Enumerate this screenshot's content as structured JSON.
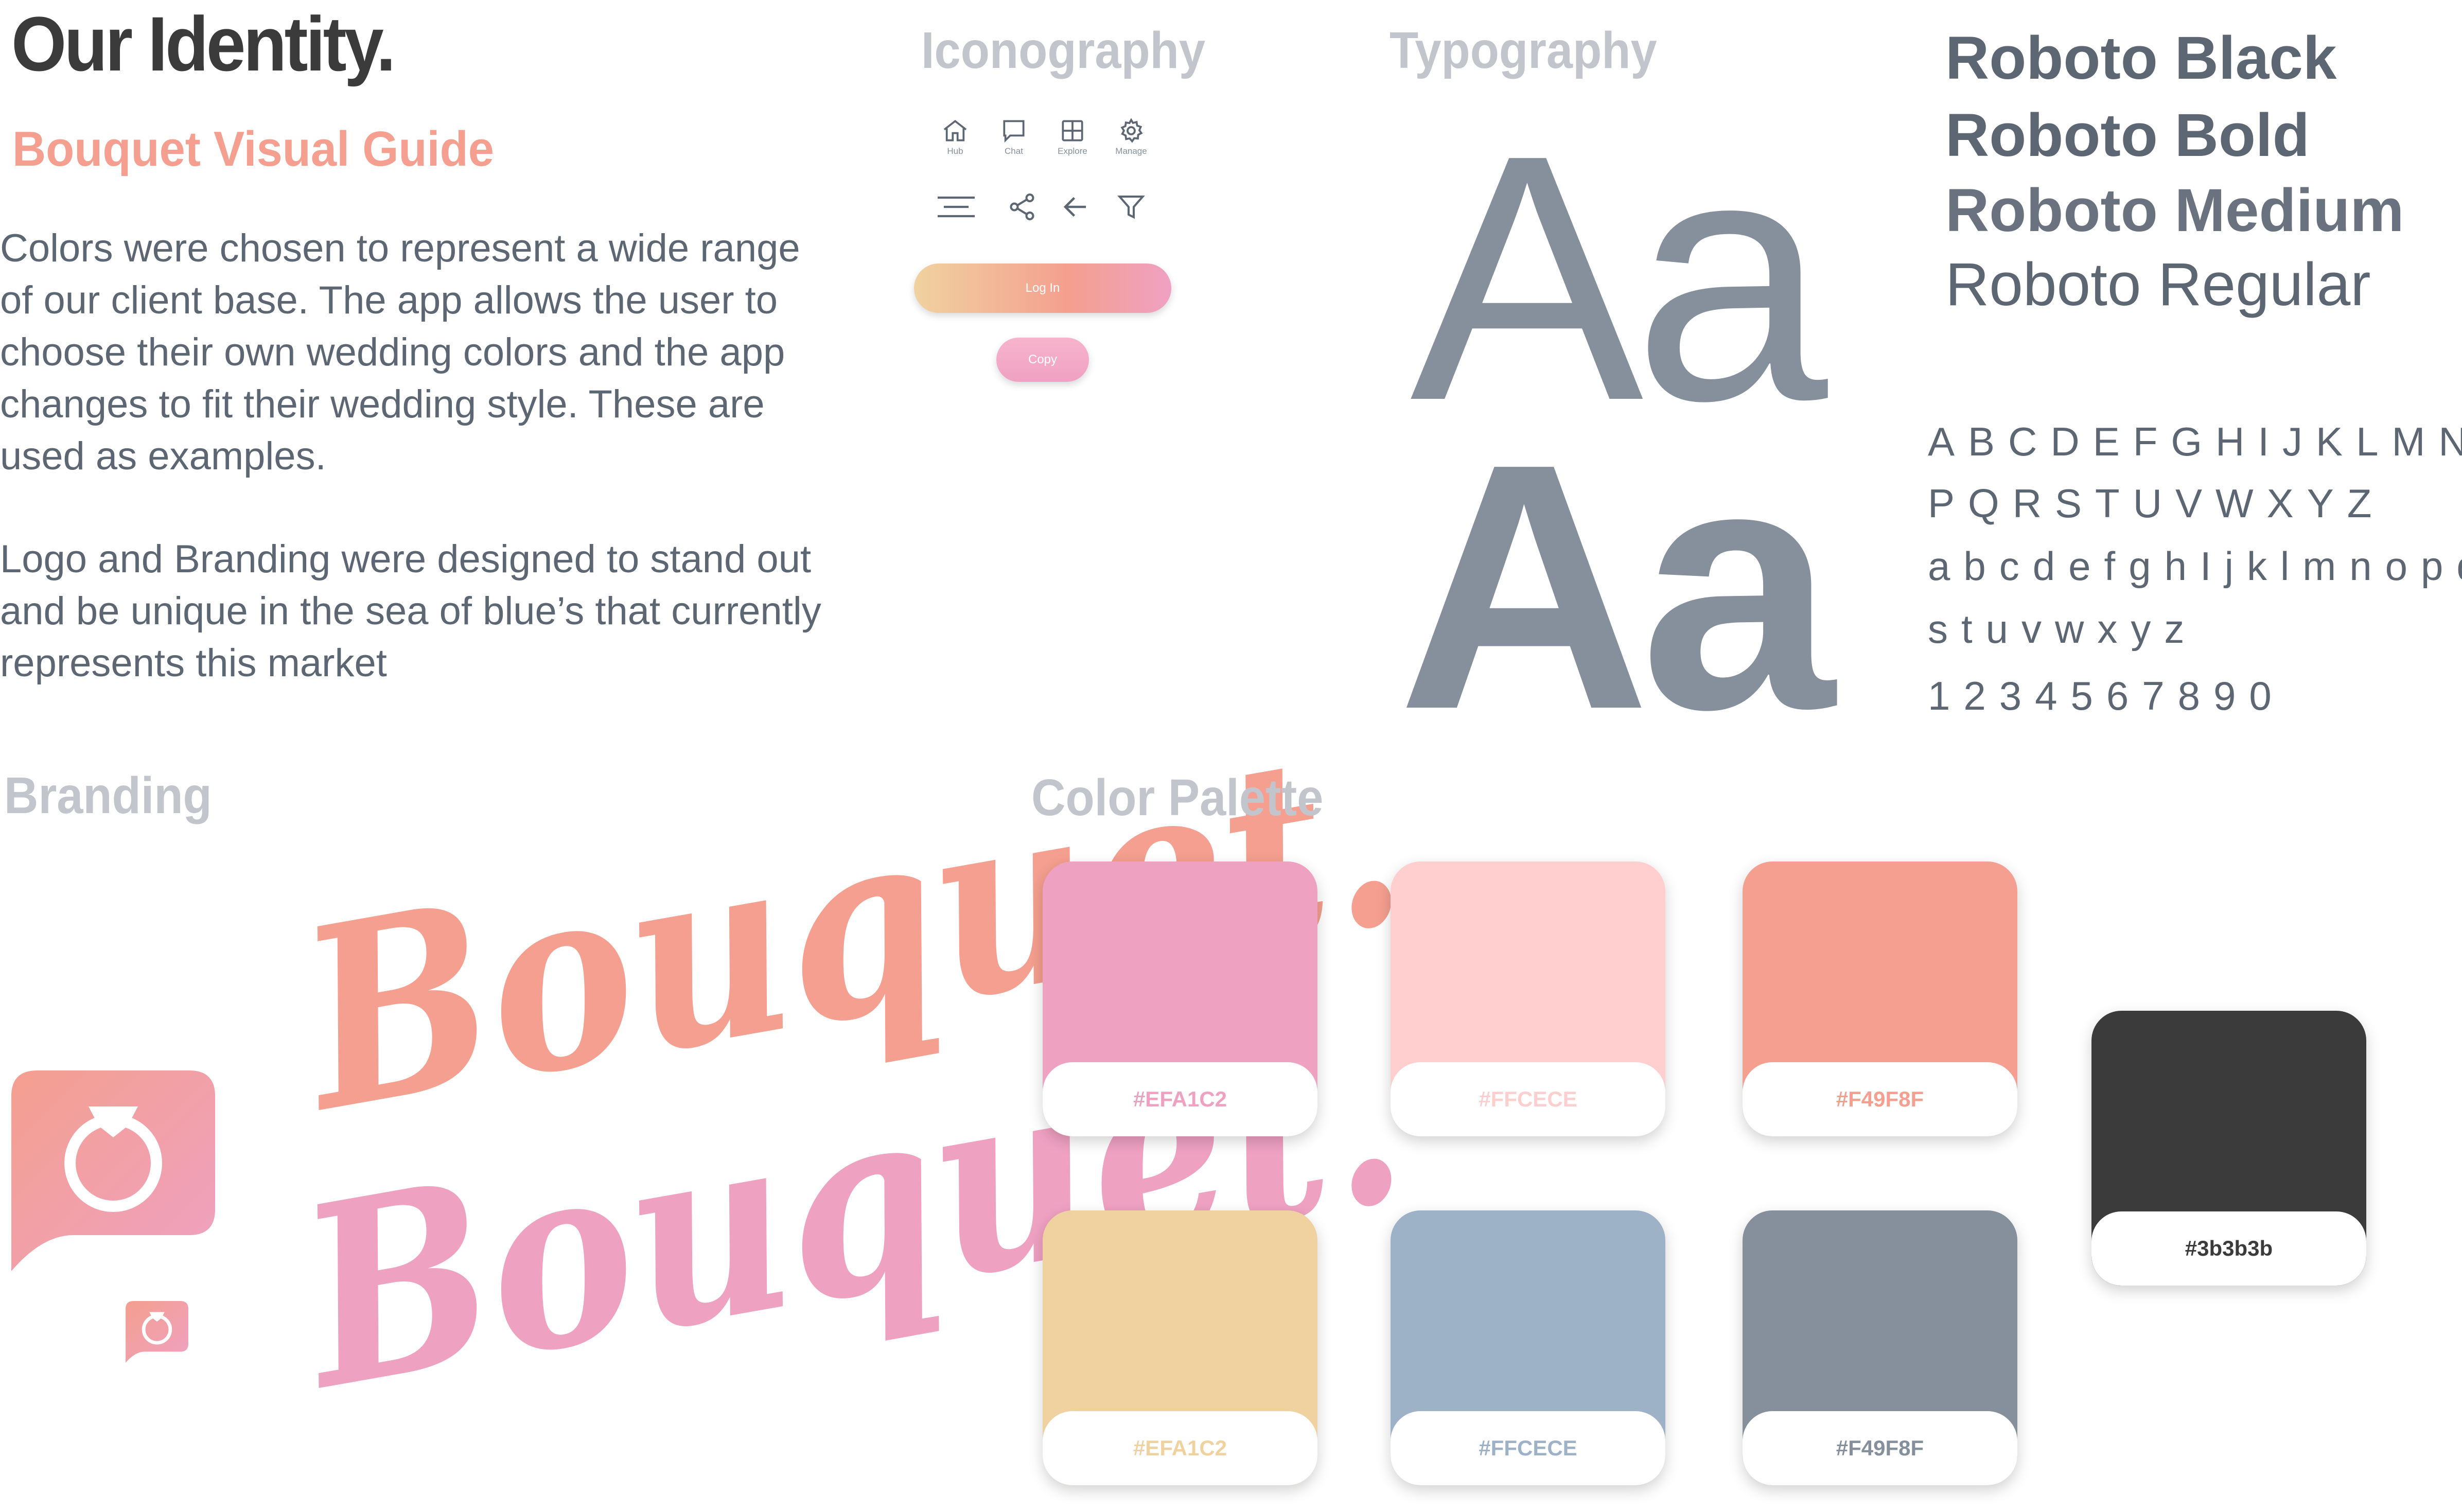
{
  "header": {
    "title": "Our Identity.",
    "subtitle": "Bouquet Visual Guide"
  },
  "intro": {
    "paragraph1": [
      "Colors were chosen to represent a wide range",
      "of our client base. The app allows the user to",
      "choose their own wedding colors and the app",
      "changes to fit their wedding style. These are",
      "used as examples."
    ],
    "paragraph2": [
      "Logo and Branding were designed to stand out",
      "and be unique in the sea of blue’s that currently",
      "represents this market"
    ]
  },
  "iconography": {
    "heading": "Iconography",
    "nav_icons": [
      {
        "icon": "home-icon",
        "label": "Hub"
      },
      {
        "icon": "chat-icon",
        "label": "Chat"
      },
      {
        "icon": "grid-icon",
        "label": "Explore"
      },
      {
        "icon": "gear-icon",
        "label": "Manage"
      }
    ],
    "tool_icons": [
      "menu-icon",
      "share-icon",
      "arrow-left-icon",
      "filter-icon"
    ],
    "login_button": "Log In",
    "copy_button": "Copy"
  },
  "typography": {
    "heading": "Typography",
    "sample_light": "Aa",
    "sample_bold": "Aa",
    "font_names": [
      "Roboto Black",
      "Roboto Bold",
      "Roboto Medium",
      "Roboto Regular"
    ],
    "alphabet": [
      "ABCDEFGHIJKLMNO",
      "PQRSTUVWXYZ",
      "abcdefghIjklmnopqr",
      "stuvwxyz",
      "1234567890"
    ]
  },
  "branding": {
    "heading": "Branding",
    "wordmark_top": "Bouquet.",
    "wordmark_bottom": "Bouquet."
  },
  "palette": {
    "heading": "Color Palette",
    "swatches": [
      {
        "fill": "#efa1c2",
        "label": "#EFA1C2",
        "label_color": "#efa1c2"
      },
      {
        "fill": "#ffcece",
        "label": "#FFCECE",
        "label_color": "#ffcece"
      },
      {
        "fill": "#f49f8f",
        "label": "#F49F8F",
        "label_color": "#f49f8f"
      },
      {
        "fill": "#3b3b3b",
        "label": "#3b3b3b",
        "label_color": "#3b3b3b"
      },
      {
        "fill": "#f0d2a0",
        "label": "#EFA1C2",
        "label_color": "#f0d2a0"
      },
      {
        "fill": "#9eb2c7",
        "label": "#FFCECE",
        "label_color": "#9eb2c7"
      },
      {
        "fill": "#85909c",
        "label": "#F49F8F",
        "label_color": "#85909c"
      }
    ]
  },
  "colors": {
    "dark": "#3b3b3b",
    "slate": "#85909c",
    "coral": "#f49f8f",
    "pink": "#efa1c2",
    "muted_heading": "#c2c6cc"
  }
}
